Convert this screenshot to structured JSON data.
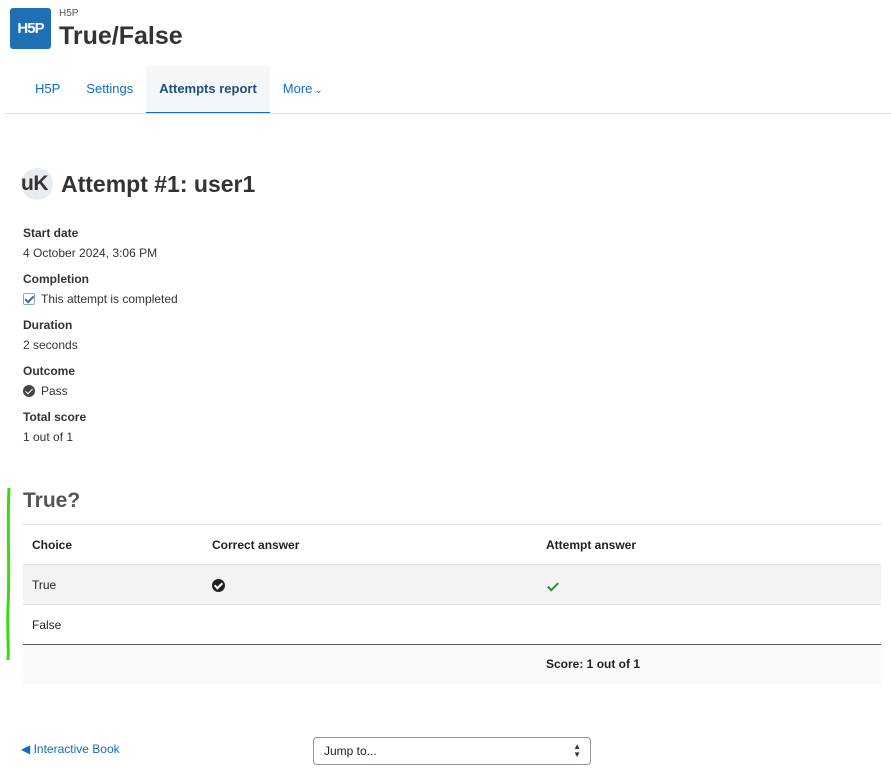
{
  "header": {
    "logo_text": "H5P",
    "pretitle": "H5P",
    "title": "True/False"
  },
  "nav": {
    "items": [
      {
        "label": "H5P"
      },
      {
        "label": "Settings"
      },
      {
        "label": "Attempts report"
      },
      {
        "label": "More"
      }
    ],
    "active": "Attempts report"
  },
  "attempt": {
    "avatar_initials": "uK",
    "title": "Attempt #1: user1",
    "details": [
      {
        "label": "Start date",
        "value": "4 October 2024, 3:06 PM"
      },
      {
        "label": "Completion",
        "value": "This attempt is completed"
      },
      {
        "label": "Duration",
        "value": "2 seconds"
      },
      {
        "label": "Outcome",
        "value": "Pass"
      },
      {
        "label": "Total score",
        "value": "1 out of 1"
      }
    ]
  },
  "question": {
    "title": "True?",
    "columns": [
      "Choice",
      "Correct answer",
      "Attempt answer"
    ],
    "rows": [
      {
        "choice": "True",
        "correct": true,
        "attempted": true
      },
      {
        "choice": "False",
        "correct": false,
        "attempted": false
      }
    ],
    "score": "Score: 1 out of 1"
  },
  "footer": {
    "prev_link": "Interactive Book",
    "jump_placeholder": "Jump to..."
  },
  "colors": {
    "brand": "#1f6fb5",
    "link": "#0f6cbf",
    "annotation": "#33dd11",
    "tick": "#3a8d3a"
  }
}
